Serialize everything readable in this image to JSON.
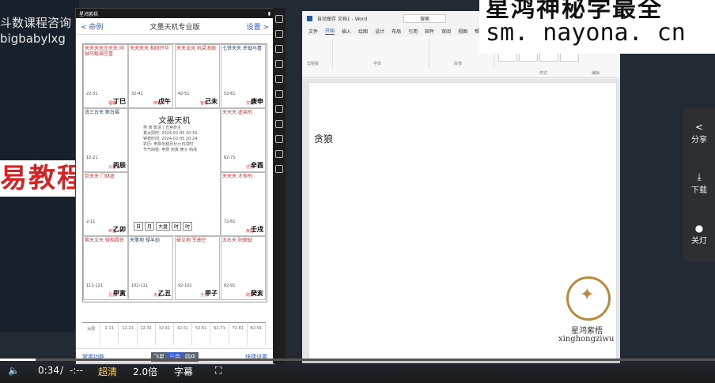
{
  "overlay": {
    "corner_text": "斗数课程咨询",
    "corner_id": "bigbabylxg",
    "edu_banner": "易教程",
    "watermark_top": "星鸿神秘学最全",
    "watermark_url": "sm. nayona. cn"
  },
  "phone_app": {
    "status_left": "星鸿紫梧",
    "back_label": "< 命例",
    "title": "文墨天机专业版",
    "settings_label": "设置 >",
    "center_title": "文墨天机",
    "center_lines": [
      "男 命 乾造 | 丑宫命主",
      "真太阳时: 2024-02-05 20:16",
      "钟表时间: 2024-02-05 20:24",
      "农历: 甲辰年腊月廿六日戌时",
      "节气四柱: 甲辰 丙寅 庚子 丙戌"
    ],
    "center_buttons": [
      "日",
      "月",
      "大盘",
      "时",
      "时"
    ],
    "cells": [
      {
        "stars": "天天天天左天天 同钺马魁福空喜",
        "range": "22-31",
        "stem": "丁巳",
        "palace": "福德"
      },
      {
        "stars": "天天天天 相府开华",
        "range": "32-41",
        "stem": "戊午",
        "palace": "田宅"
      },
      {
        "stars": "天天龙凤 机梁池阁",
        "range": "42-51",
        "stem": "己未",
        "palace": "官禄"
      },
      {
        "stars": "七铁天天 杀钺马喜",
        "range": "52-61",
        "stem": "庚申",
        "palace": "交友"
      },
      {
        "stars": "贪三台天 狼台福",
        "range": "12-21",
        "stem": "丙辰",
        "palace": "父母"
      },
      {
        "stars": "天天天 虚哭刑",
        "range": "62-71",
        "stem": "辛酉",
        "palace": "迁移"
      },
      {
        "stars": "巨天天 门姚虚",
        "range": "2-11",
        "stem": "乙卯",
        "palace": "命宫"
      },
      {
        "stars": "天天天 才寿刑",
        "range": "72-81",
        "stem": "壬戌",
        "palace": "疾厄"
      },
      {
        "stars": "紫天文天 微相昌铁",
        "range": "112-121",
        "stem": "甲寅",
        "palace": "兄弟"
      },
      {
        "stars": "天擎地 禄羊劫",
        "range": "102-111",
        "stem": "乙丑",
        "palace": "夫妻"
      },
      {
        "stars": "破文地 军曲空",
        "range": "92-101",
        "stem": "甲子",
        "palace": "子女"
      },
      {
        "stars": "太右天 阳弼钺",
        "range": "82-91",
        "stem": "癸亥",
        "palace": "财帛"
      }
    ],
    "timeline": [
      "大限",
      "2-11",
      "12-21",
      "22-31",
      "32-41",
      "42-51",
      "52-61",
      "62-71",
      "72-81",
      "82-91"
    ],
    "footer_left": "常用功能",
    "footer_seg": [
      "飞星",
      "三合",
      "四化"
    ],
    "footer_right": "快捷设置"
  },
  "word": {
    "title": "自动保存  文档1 - Word",
    "search_placeholder": "搜索",
    "tabs": [
      "文件",
      "开始",
      "插入",
      "绘图",
      "设计",
      "布局",
      "引用",
      "邮件",
      "审阅",
      "视图",
      "帮助"
    ],
    "active_tab": "开始",
    "ribbon_groups": [
      "剪贴板",
      "字体",
      "段落",
      "样式",
      "编辑"
    ],
    "style_items": [
      "正文",
      "无间隔",
      "标题1",
      "标题2"
    ],
    "document_text": "贪狼",
    "brand_cn": "星鸿紫梧",
    "brand_en": "xinghongziwu"
  },
  "side_panel": [
    {
      "icon": "share-icon",
      "label": "分享"
    },
    {
      "icon": "download-icon",
      "label": "下载"
    },
    {
      "icon": "light-icon",
      "label": "关灯"
    }
  ],
  "player": {
    "time": "0:34",
    "separator": "/",
    "duration": "-:--",
    "quality": "超清",
    "speed": "2.0倍",
    "subtitle": "字幕",
    "progress": 0.05
  }
}
